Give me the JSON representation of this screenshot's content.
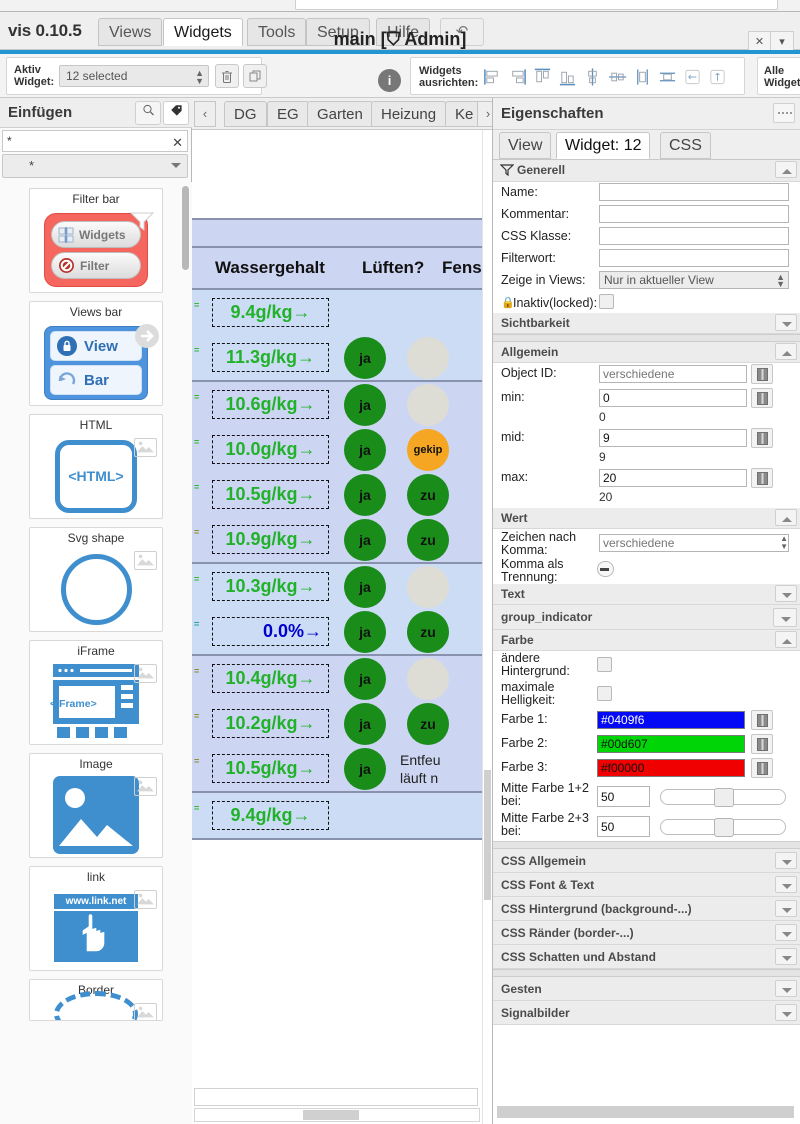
{
  "menubar": {
    "brand": "vis 0.10.5",
    "tabs": [
      {
        "label": "Views",
        "active": false
      },
      {
        "label": "Widgets",
        "active": true
      },
      {
        "label": "Tools",
        "active": false
      },
      {
        "label": "Setup",
        "active": false
      },
      {
        "label": "Hilfe",
        "active": false
      }
    ],
    "undo_icon": "undo-arrow-icon",
    "title": "main [⛉ Admin]",
    "window_buttons": [
      "✕",
      "▾"
    ]
  },
  "toolbar": {
    "active_widget_label": "Aktiv\nWidget:",
    "active_widget_label_line1": "Aktiv",
    "active_widget_label_line2": "Widget:",
    "active_widget_value": "12 selected",
    "delete_icon": "trash-icon",
    "copy_icon": "copy-icon",
    "info_icon": "info-icon",
    "align_label_line1": "Widgets",
    "align_label_line2": "ausrichten:",
    "align_icons": [
      "align-left-icon",
      "align-right-icon",
      "align-top-icon",
      "align-bottom-icon",
      "align-center-vertical-icon",
      "align-middle-horizontal-icon",
      "distribute-horizontal-icon",
      "distribute-vertical-icon",
      "same-width-icon",
      "same-height-icon"
    ],
    "all_widgets_line1": "Alle",
    "all_widgets_line2": "Widgets"
  },
  "left_panel": {
    "title": "Einfügen",
    "search_icon": "magnifier-icon",
    "tag_icon": "tag-icon",
    "search_value": "*",
    "clear_icon": "✕",
    "filter_value": "*",
    "widgets": [
      {
        "caption": "Filter bar",
        "kind": "filterbar",
        "labels": [
          "Widgets",
          "Filter"
        ],
        "has_img_icon": false
      },
      {
        "caption": "Views bar",
        "kind": "viewsbar",
        "labels": [
          "View",
          "Bar"
        ],
        "has_img_icon": false
      },
      {
        "caption": "HTML",
        "kind": "html",
        "labels": [
          "<HTML>"
        ],
        "has_img_icon": true
      },
      {
        "caption": "Svg shape",
        "kind": "svg",
        "labels": [],
        "has_img_icon": true
      },
      {
        "caption": "iFrame",
        "kind": "iframe",
        "labels": [
          "<iFrame>"
        ],
        "has_img_icon": true
      },
      {
        "caption": "Image",
        "kind": "image",
        "labels": [],
        "has_img_icon": true
      },
      {
        "caption": "link",
        "kind": "link",
        "labels": [
          "www.link.net"
        ],
        "has_img_icon": true
      },
      {
        "caption": "Border",
        "kind": "border",
        "labels": [],
        "has_img_icon": true
      }
    ]
  },
  "center": {
    "nav_prev": "‹",
    "nav_next": "›",
    "view_tabs": [
      "DG",
      "EG",
      "Garten",
      "Heizung",
      "Ke"
    ],
    "table": {
      "headers": [
        "Wassergehalt",
        "Lüften?",
        "Fens"
      ],
      "rows": [
        {
          "value": "9.4g/kg→",
          "color": "green",
          "dot1": "",
          "dot1_color": "none",
          "dot2": "",
          "dot2_color": "none",
          "group_end": false,
          "shade": "light"
        },
        {
          "value": "11.3g/kg→",
          "color": "green",
          "dot1": "ja",
          "dot1_color": "green",
          "dot2": "",
          "dot2_color": "grey",
          "group_end": true,
          "shade": "light"
        },
        {
          "value": "10.6g/kg→",
          "color": "green",
          "dot1": "ja",
          "dot1_color": "green",
          "dot2": "",
          "dot2_color": "grey",
          "group_end": false,
          "shade": "dark"
        },
        {
          "value": "10.0g/kg→",
          "color": "green",
          "dot1": "ja",
          "dot1_color": "green",
          "dot2": "gekip",
          "dot2_color": "orange",
          "group_end": false,
          "shade": "dark"
        },
        {
          "value": "10.5g/kg→",
          "color": "green",
          "dot1": "ja",
          "dot1_color": "green",
          "dot2": "zu",
          "dot2_color": "green",
          "group_end": false,
          "shade": "dark"
        },
        {
          "value": "10.9g/kg→",
          "color": "green",
          "dot1": "ja",
          "dot1_color": "green",
          "dot2": "zu",
          "dot2_color": "green",
          "group_end": true,
          "shade": "dark"
        },
        {
          "value": "10.3g/kg→",
          "color": "green",
          "dot1": "ja",
          "dot1_color": "green",
          "dot2": "",
          "dot2_color": "grey",
          "group_end": false,
          "shade": "light"
        },
        {
          "value": "0.0%→",
          "color": "blue",
          "dot1": "ja",
          "dot1_color": "green",
          "dot2": "zu",
          "dot2_color": "green",
          "group_end": true,
          "shade": "light"
        },
        {
          "value": "10.4g/kg→",
          "color": "green",
          "dot1": "ja",
          "dot1_color": "green",
          "dot2": "",
          "dot2_color": "grey",
          "group_end": false,
          "shade": "dark"
        },
        {
          "value": "10.2g/kg→",
          "color": "green",
          "dot1": "ja",
          "dot1_color": "green",
          "dot2": "zu",
          "dot2_color": "green",
          "group_end": false,
          "shade": "dark"
        },
        {
          "value": "10.5g/kg→",
          "color": "green",
          "dot1": "ja",
          "dot1_color": "green",
          "dot2": "Entfeu…\nläuft n",
          "dot2_color": "text",
          "group_end": true,
          "shade": "dark"
        },
        {
          "value": "9.4g/kg→",
          "color": "green",
          "dot1": "",
          "dot1_color": "none",
          "dot2": "",
          "dot2_color": "none",
          "group_end": true,
          "shade": "light"
        }
      ],
      "row_text_dehumid_line1": "Entfeu",
      "row_text_dehumid_line2": "läuft n"
    }
  },
  "right_panel": {
    "title": "Eigenschaften",
    "grip_icon": "drag-grip-icon",
    "tabs": [
      {
        "label": "View",
        "active": false
      },
      {
        "label": "Widget: 12",
        "active": true
      },
      {
        "label": "CSS",
        "active": false
      }
    ],
    "groups": {
      "generell": {
        "label": "Generell",
        "expanded": true,
        "icon": "funnel-icon"
      },
      "sichtbarkeit": {
        "label": "Sichtbarkeit",
        "expanded": false
      },
      "allgemein": {
        "label": "Allgemein",
        "expanded": true
      },
      "wert": {
        "label": "Wert",
        "expanded": true
      },
      "text": {
        "label": "Text",
        "expanded": false
      },
      "group_indicator": {
        "label": "group_indicator",
        "expanded": false
      },
      "farbe": {
        "label": "Farbe",
        "expanded": true
      },
      "css_allgemein": {
        "label": "CSS Allgemein",
        "expanded": false
      },
      "css_font": {
        "label": "CSS Font & Text",
        "expanded": false
      },
      "css_hintergrund": {
        "label": "CSS Hintergrund (background-...)",
        "expanded": false
      },
      "css_raender": {
        "label": "CSS Ränder (border-...)",
        "expanded": false
      },
      "css_schatten": {
        "label": "CSS Schatten und Abstand",
        "expanded": false
      },
      "gesten": {
        "label": "Gesten",
        "expanded": false
      },
      "signalbilder": {
        "label": "Signalbilder",
        "expanded": false
      }
    },
    "fields": {
      "name_label": "Name:",
      "name_value": "",
      "kommentar_label": "Kommentar:",
      "kommentar_value": "",
      "css_klasse_label": "CSS Klasse:",
      "css_klasse_value": "",
      "filterwort_label": "Filterwort:",
      "filterwort_value": "",
      "zeige_in_views_label": "Zeige in Views:",
      "zeige_in_views_value": "Nur in aktueller View",
      "inaktiv_label": "Inaktiv(locked):",
      "inaktiv_checked": false,
      "object_id_label": "Object ID:",
      "object_id_placeholder": "verschiedene",
      "min_label": "min:",
      "min_value": "0",
      "min_sub": "0",
      "mid_label": "mid:",
      "mid_value": "9",
      "mid_sub": "9",
      "max_label": "max:",
      "max_value": "20",
      "max_sub": "20",
      "zeichen_label_l1": "Zeichen nach",
      "zeichen_label_l2": "Komma:",
      "zeichen_placeholder": "verschiedene",
      "komma_label_l1": "Komma als",
      "komma_label_l2": "Trennung:",
      "aendere_l1": "ändere",
      "aendere_l2": "Hintergrund:",
      "aendere_checked": false,
      "maximale_l1": "maximale",
      "maximale_l2": "Helligkeit:",
      "maximale_checked": false,
      "farbe1_label": "Farbe 1:",
      "farbe1_value": "#0409f6",
      "farbe2_label": "Farbe 2:",
      "farbe2_value": "#00d607",
      "farbe3_label": "Farbe 3:",
      "farbe3_value": "#f00000",
      "mitte12_l1": "Mitte Farbe 1+2",
      "mitte12_l2": "bei:",
      "mitte12_value": "50",
      "mitte23_l1": "Mitte Farbe 2+3",
      "mitte23_l2": "bei:",
      "mitte23_value": "50"
    },
    "colors": {
      "farbe1": "#0409f6",
      "farbe2": "#00d607",
      "farbe3": "#f00000"
    }
  },
  "theme": {
    "accent": "#2196d3",
    "table_bg_light": "#ccdcf5",
    "table_bg_dark": "#ccd5f2",
    "table_border": "#8892ad",
    "value_green": "#22b22a",
    "value_blue": "#0000cc",
    "dot_green": "#1a8c1a",
    "dot_orange": "#f5a623",
    "dot_grey": "#ddddd6"
  }
}
